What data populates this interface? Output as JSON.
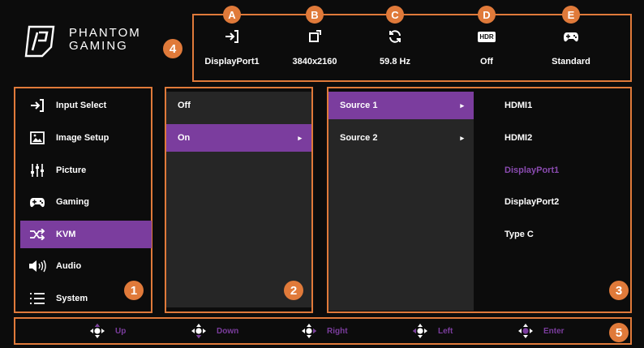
{
  "logo": {
    "line1": "PHANTOM",
    "line2": "GAMING"
  },
  "status": [
    {
      "letter": "A",
      "icon": "input-arrow-icon",
      "value": "DisplayPort1"
    },
    {
      "letter": "B",
      "icon": "resolution-icon",
      "value": "3840x2160"
    },
    {
      "letter": "C",
      "icon": "refresh-icon",
      "value": "59.8 Hz"
    },
    {
      "letter": "D",
      "icon": "hdr-icon",
      "value": "Off",
      "icon_text": "HDR"
    },
    {
      "letter": "E",
      "icon": "gamepad-icon",
      "value": "Standard"
    }
  ],
  "sidebar": {
    "items": [
      {
        "label": "Input Select",
        "icon": "input-arrow-icon"
      },
      {
        "label": "Image Setup",
        "icon": "image-icon"
      },
      {
        "label": "Picture",
        "icon": "sliders-icon"
      },
      {
        "label": "Gaming",
        "icon": "gamepad-icon"
      },
      {
        "label": "KVM",
        "icon": "shuffle-icon",
        "active": true
      },
      {
        "label": "Audio",
        "icon": "speaker-icon"
      },
      {
        "label": "System",
        "icon": "list-icon"
      }
    ]
  },
  "submenu": {
    "items": [
      {
        "label": "Off"
      },
      {
        "label": "On",
        "active": true,
        "chevron": "▸"
      }
    ]
  },
  "sources": {
    "items": [
      {
        "label": "Source 1",
        "active": true,
        "chevron": "▸"
      },
      {
        "label": "Source 2",
        "chevron": "▸"
      }
    ]
  },
  "options": {
    "items": [
      {
        "label": "HDMI1"
      },
      {
        "label": "HDMI2"
      },
      {
        "label": "DisplayPort1",
        "selected": true
      },
      {
        "label": "DisplayPort2"
      },
      {
        "label": "Type C"
      }
    ]
  },
  "navbar": {
    "items": [
      {
        "label": "Up"
      },
      {
        "label": "Down"
      },
      {
        "label": "Right"
      },
      {
        "label": "Left"
      },
      {
        "label": "Enter"
      }
    ]
  },
  "callouts": {
    "c1": "1",
    "c2": "2",
    "c3": "3",
    "c4": "4",
    "c5": "5"
  },
  "colors": {
    "accent": "#e07a3a",
    "highlight": "#7b3d9e",
    "panel": "#262626",
    "selected_text": "#8a4bb0"
  }
}
